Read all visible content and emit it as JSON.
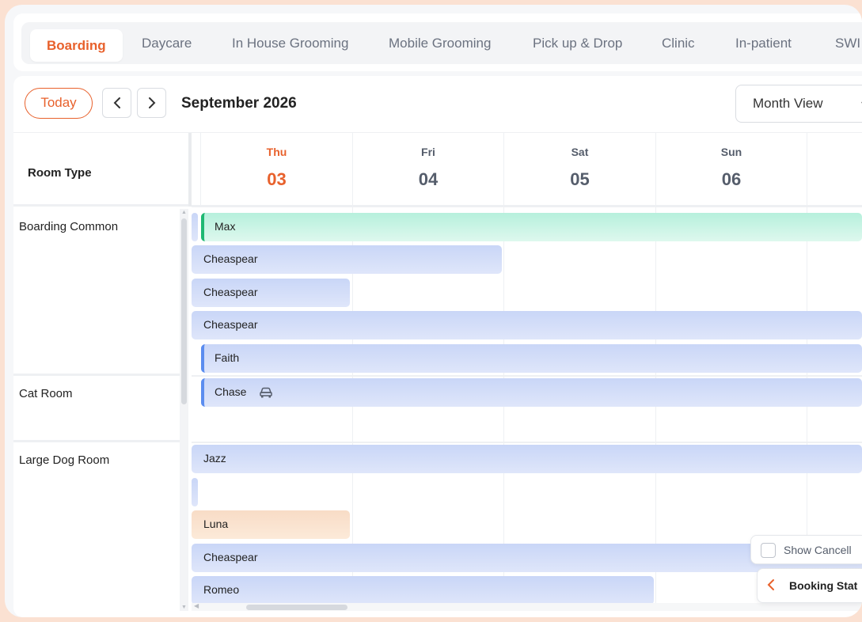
{
  "tabs": [
    {
      "label": "Boarding",
      "active": true
    },
    {
      "label": "Daycare"
    },
    {
      "label": "In House Grooming"
    },
    {
      "label": "Mobile Grooming"
    },
    {
      "label": "Pick up & Drop"
    },
    {
      "label": "Clinic"
    },
    {
      "label": "In-patient"
    },
    {
      "label": "SWI"
    }
  ],
  "toolbar": {
    "today_label": "Today",
    "month_title": "September 2026",
    "view_select": "Month View"
  },
  "grid": {
    "room_type_header": "Room Type",
    "days": [
      {
        "dow": "Thu",
        "num": "03",
        "today": true
      },
      {
        "dow": "Fri",
        "num": "04"
      },
      {
        "dow": "Sat",
        "num": "05"
      },
      {
        "dow": "Sun",
        "num": "06"
      }
    ],
    "rooms": [
      "Boarding Common",
      "Cat Room",
      "Large Dog Room"
    ]
  },
  "bookings": [
    {
      "name": "Max",
      "room": "Boarding Common",
      "style": "green"
    },
    {
      "name": "Cheaspear",
      "room": "Boarding Common"
    },
    {
      "name": "Cheaspear",
      "room": "Boarding Common"
    },
    {
      "name": "Cheaspear",
      "room": "Boarding Common"
    },
    {
      "name": "Faith",
      "room": "Boarding Common",
      "style": "blue-edge"
    },
    {
      "name": "Chase",
      "room": "Cat Room",
      "style": "blue-edge",
      "icon": "car-icon"
    },
    {
      "name": "Jazz",
      "room": "Large Dog Room"
    },
    {
      "name": "",
      "room": "Large Dog Room"
    },
    {
      "name": "Luna",
      "room": "Large Dog Room",
      "style": "orange"
    },
    {
      "name": "Cheaspear",
      "room": "Large Dog Room"
    },
    {
      "name": "Romeo",
      "room": "Large Dog Room"
    }
  ],
  "controls": {
    "show_cancelled_label": "Show Cancell",
    "booking_status_label": "Booking Stat"
  },
  "colors": {
    "accent": "#e8612c",
    "green_edge": "#1fb873",
    "blue_edge": "#5b8def",
    "bar_blue": "#c9d6f7",
    "bar_orange": "#f8dcc6"
  }
}
